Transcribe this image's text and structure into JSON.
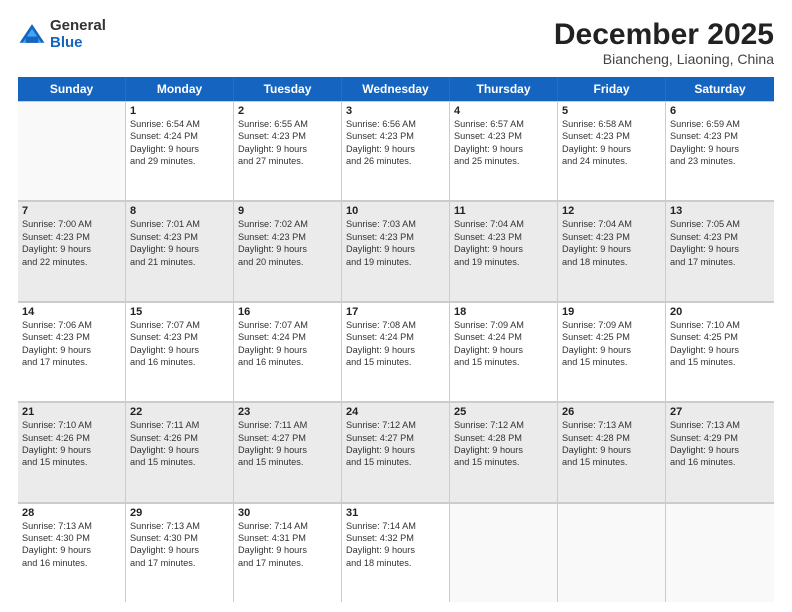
{
  "logo": {
    "general": "General",
    "blue": "Blue"
  },
  "header": {
    "month": "December 2025",
    "location": "Biancheng, Liaoning, China"
  },
  "weekdays": [
    "Sunday",
    "Monday",
    "Tuesday",
    "Wednesday",
    "Thursday",
    "Friday",
    "Saturday"
  ],
  "weeks": [
    [
      {
        "day": "",
        "empty": true,
        "shaded": false,
        "lines": []
      },
      {
        "day": "1",
        "empty": false,
        "shaded": false,
        "lines": [
          "Sunrise: 6:54 AM",
          "Sunset: 4:24 PM",
          "Daylight: 9 hours",
          "and 29 minutes."
        ]
      },
      {
        "day": "2",
        "empty": false,
        "shaded": false,
        "lines": [
          "Sunrise: 6:55 AM",
          "Sunset: 4:23 PM",
          "Daylight: 9 hours",
          "and 27 minutes."
        ]
      },
      {
        "day": "3",
        "empty": false,
        "shaded": false,
        "lines": [
          "Sunrise: 6:56 AM",
          "Sunset: 4:23 PM",
          "Daylight: 9 hours",
          "and 26 minutes."
        ]
      },
      {
        "day": "4",
        "empty": false,
        "shaded": false,
        "lines": [
          "Sunrise: 6:57 AM",
          "Sunset: 4:23 PM",
          "Daylight: 9 hours",
          "and 25 minutes."
        ]
      },
      {
        "day": "5",
        "empty": false,
        "shaded": false,
        "lines": [
          "Sunrise: 6:58 AM",
          "Sunset: 4:23 PM",
          "Daylight: 9 hours",
          "and 24 minutes."
        ]
      },
      {
        "day": "6",
        "empty": false,
        "shaded": false,
        "lines": [
          "Sunrise: 6:59 AM",
          "Sunset: 4:23 PM",
          "Daylight: 9 hours",
          "and 23 minutes."
        ]
      }
    ],
    [
      {
        "day": "7",
        "empty": false,
        "shaded": true,
        "lines": [
          "Sunrise: 7:00 AM",
          "Sunset: 4:23 PM",
          "Daylight: 9 hours",
          "and 22 minutes."
        ]
      },
      {
        "day": "8",
        "empty": false,
        "shaded": true,
        "lines": [
          "Sunrise: 7:01 AM",
          "Sunset: 4:23 PM",
          "Daylight: 9 hours",
          "and 21 minutes."
        ]
      },
      {
        "day": "9",
        "empty": false,
        "shaded": true,
        "lines": [
          "Sunrise: 7:02 AM",
          "Sunset: 4:23 PM",
          "Daylight: 9 hours",
          "and 20 minutes."
        ]
      },
      {
        "day": "10",
        "empty": false,
        "shaded": true,
        "lines": [
          "Sunrise: 7:03 AM",
          "Sunset: 4:23 PM",
          "Daylight: 9 hours",
          "and 19 minutes."
        ]
      },
      {
        "day": "11",
        "empty": false,
        "shaded": true,
        "lines": [
          "Sunrise: 7:04 AM",
          "Sunset: 4:23 PM",
          "Daylight: 9 hours",
          "and 19 minutes."
        ]
      },
      {
        "day": "12",
        "empty": false,
        "shaded": true,
        "lines": [
          "Sunrise: 7:04 AM",
          "Sunset: 4:23 PM",
          "Daylight: 9 hours",
          "and 18 minutes."
        ]
      },
      {
        "day": "13",
        "empty": false,
        "shaded": true,
        "lines": [
          "Sunrise: 7:05 AM",
          "Sunset: 4:23 PM",
          "Daylight: 9 hours",
          "and 17 minutes."
        ]
      }
    ],
    [
      {
        "day": "14",
        "empty": false,
        "shaded": false,
        "lines": [
          "Sunrise: 7:06 AM",
          "Sunset: 4:23 PM",
          "Daylight: 9 hours",
          "and 17 minutes."
        ]
      },
      {
        "day": "15",
        "empty": false,
        "shaded": false,
        "lines": [
          "Sunrise: 7:07 AM",
          "Sunset: 4:23 PM",
          "Daylight: 9 hours",
          "and 16 minutes."
        ]
      },
      {
        "day": "16",
        "empty": false,
        "shaded": false,
        "lines": [
          "Sunrise: 7:07 AM",
          "Sunset: 4:24 PM",
          "Daylight: 9 hours",
          "and 16 minutes."
        ]
      },
      {
        "day": "17",
        "empty": false,
        "shaded": false,
        "lines": [
          "Sunrise: 7:08 AM",
          "Sunset: 4:24 PM",
          "Daylight: 9 hours",
          "and 15 minutes."
        ]
      },
      {
        "day": "18",
        "empty": false,
        "shaded": false,
        "lines": [
          "Sunrise: 7:09 AM",
          "Sunset: 4:24 PM",
          "Daylight: 9 hours",
          "and 15 minutes."
        ]
      },
      {
        "day": "19",
        "empty": false,
        "shaded": false,
        "lines": [
          "Sunrise: 7:09 AM",
          "Sunset: 4:25 PM",
          "Daylight: 9 hours",
          "and 15 minutes."
        ]
      },
      {
        "day": "20",
        "empty": false,
        "shaded": false,
        "lines": [
          "Sunrise: 7:10 AM",
          "Sunset: 4:25 PM",
          "Daylight: 9 hours",
          "and 15 minutes."
        ]
      }
    ],
    [
      {
        "day": "21",
        "empty": false,
        "shaded": true,
        "lines": [
          "Sunrise: 7:10 AM",
          "Sunset: 4:26 PM",
          "Daylight: 9 hours",
          "and 15 minutes."
        ]
      },
      {
        "day": "22",
        "empty": false,
        "shaded": true,
        "lines": [
          "Sunrise: 7:11 AM",
          "Sunset: 4:26 PM",
          "Daylight: 9 hours",
          "and 15 minutes."
        ]
      },
      {
        "day": "23",
        "empty": false,
        "shaded": true,
        "lines": [
          "Sunrise: 7:11 AM",
          "Sunset: 4:27 PM",
          "Daylight: 9 hours",
          "and 15 minutes."
        ]
      },
      {
        "day": "24",
        "empty": false,
        "shaded": true,
        "lines": [
          "Sunrise: 7:12 AM",
          "Sunset: 4:27 PM",
          "Daylight: 9 hours",
          "and 15 minutes."
        ]
      },
      {
        "day": "25",
        "empty": false,
        "shaded": true,
        "lines": [
          "Sunrise: 7:12 AM",
          "Sunset: 4:28 PM",
          "Daylight: 9 hours",
          "and 15 minutes."
        ]
      },
      {
        "day": "26",
        "empty": false,
        "shaded": true,
        "lines": [
          "Sunrise: 7:13 AM",
          "Sunset: 4:28 PM",
          "Daylight: 9 hours",
          "and 15 minutes."
        ]
      },
      {
        "day": "27",
        "empty": false,
        "shaded": true,
        "lines": [
          "Sunrise: 7:13 AM",
          "Sunset: 4:29 PM",
          "Daylight: 9 hours",
          "and 16 minutes."
        ]
      }
    ],
    [
      {
        "day": "28",
        "empty": false,
        "shaded": false,
        "lines": [
          "Sunrise: 7:13 AM",
          "Sunset: 4:30 PM",
          "Daylight: 9 hours",
          "and 16 minutes."
        ]
      },
      {
        "day": "29",
        "empty": false,
        "shaded": false,
        "lines": [
          "Sunrise: 7:13 AM",
          "Sunset: 4:30 PM",
          "Daylight: 9 hours",
          "and 17 minutes."
        ]
      },
      {
        "day": "30",
        "empty": false,
        "shaded": false,
        "lines": [
          "Sunrise: 7:14 AM",
          "Sunset: 4:31 PM",
          "Daylight: 9 hours",
          "and 17 minutes."
        ]
      },
      {
        "day": "31",
        "empty": false,
        "shaded": false,
        "lines": [
          "Sunrise: 7:14 AM",
          "Sunset: 4:32 PM",
          "Daylight: 9 hours",
          "and 18 minutes."
        ]
      },
      {
        "day": "",
        "empty": true,
        "shaded": false,
        "lines": []
      },
      {
        "day": "",
        "empty": true,
        "shaded": false,
        "lines": []
      },
      {
        "day": "",
        "empty": true,
        "shaded": false,
        "lines": []
      }
    ]
  ]
}
